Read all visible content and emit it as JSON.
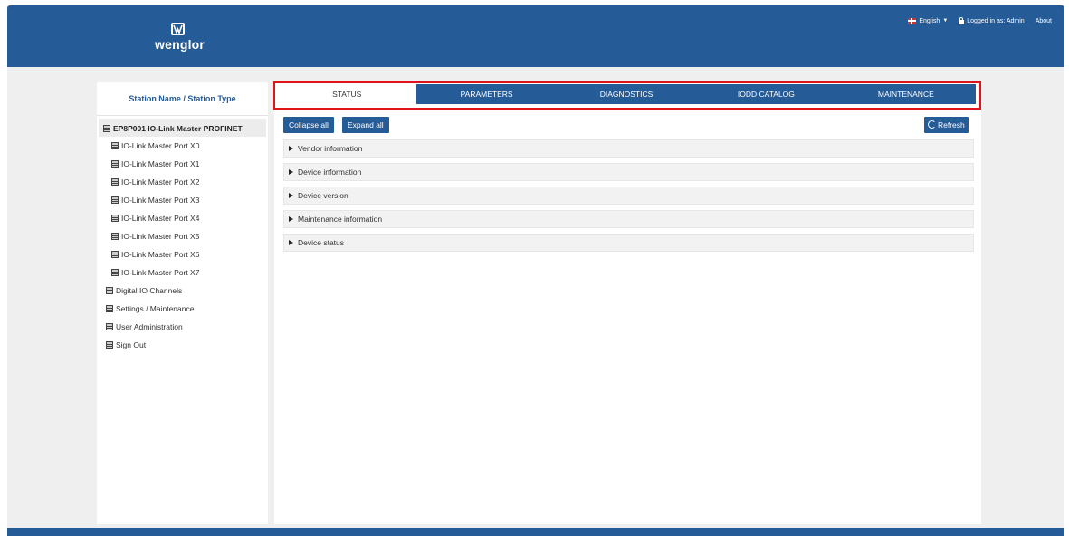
{
  "brand": {
    "name": "wenglor"
  },
  "topnav": {
    "language": "English",
    "logged_in": "Logged in as: Admin",
    "about": "About"
  },
  "sidebar": {
    "title": "Station Name / Station Type",
    "root": "EP8P001 IO-Link Master PROFINET",
    "ports": [
      "IO-Link Master Port X0",
      "IO-Link Master Port X1",
      "IO-Link Master Port X2",
      "IO-Link Master Port X3",
      "IO-Link Master Port X4",
      "IO-Link Master Port X5",
      "IO-Link Master Port X6",
      "IO-Link Master Port X7"
    ],
    "items": [
      "Digital IO Channels",
      "Settings / Maintenance",
      "User Administration",
      "Sign Out"
    ]
  },
  "tabs": [
    "STATUS",
    "PARAMETERS",
    "DIAGNOSTICS",
    "IODD CATALOG",
    "MAINTENANCE"
  ],
  "active_tab": "STATUS",
  "toolbar": {
    "collapse": "Collapse all",
    "expand": "Expand all",
    "refresh": "Refresh"
  },
  "sections": [
    "Vendor information",
    "Device information",
    "Device version",
    "Maintenance information",
    "Device status"
  ],
  "colors": {
    "brand_blue": "#255b97",
    "highlight_red": "#e0121b"
  }
}
